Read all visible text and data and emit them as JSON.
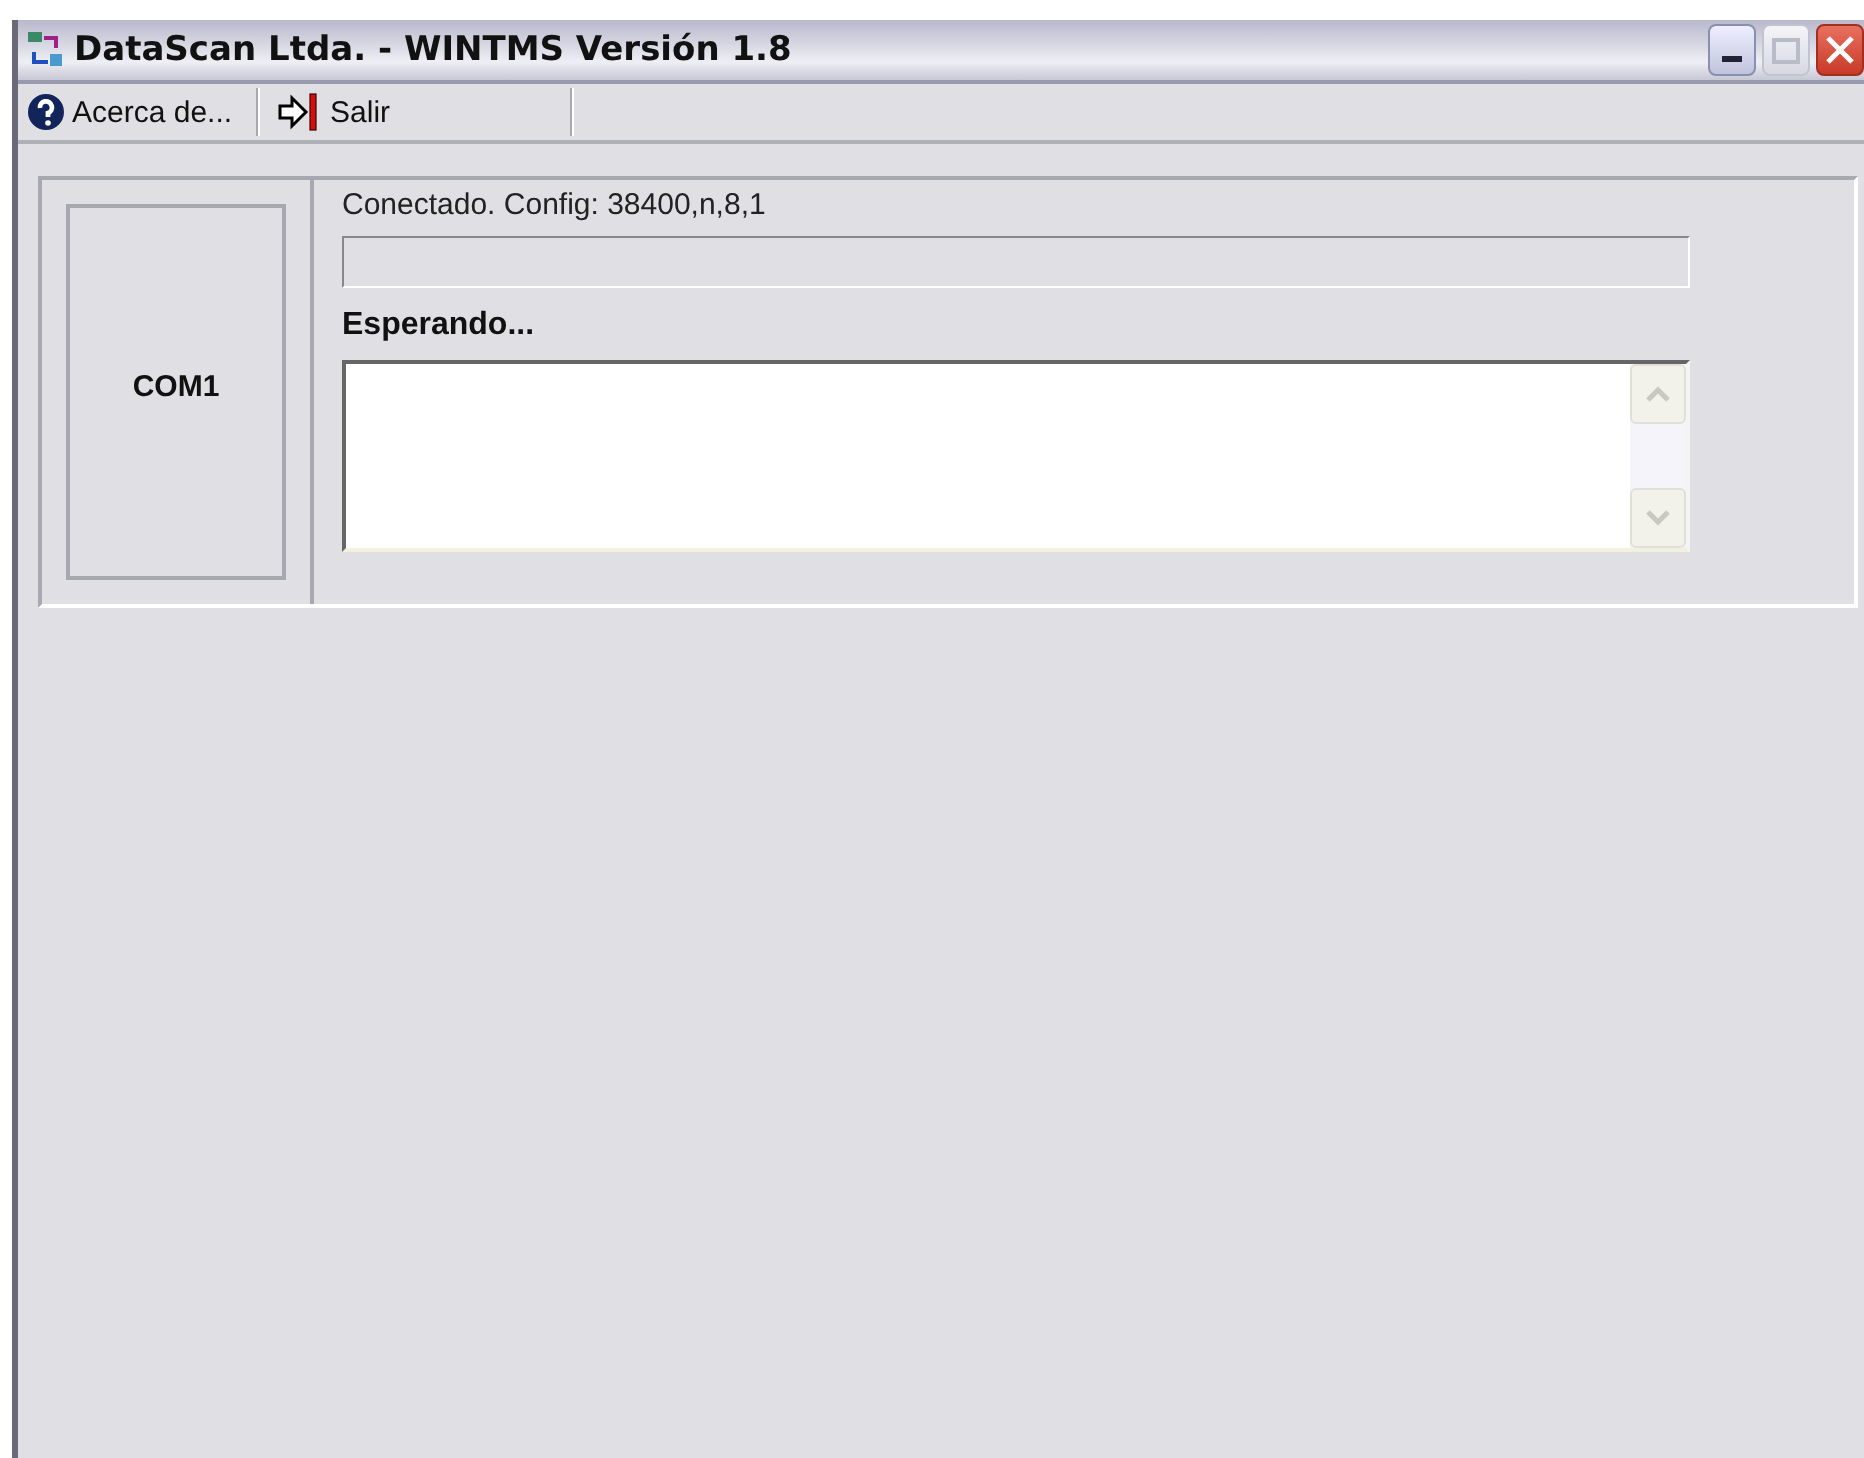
{
  "window": {
    "title": "DataScan Ltda. - WINTMS Versión 1.8"
  },
  "toolbar": [
    {
      "label": "Acerca de...",
      "kind": "help"
    },
    {
      "label": "Salir",
      "kind": "exit"
    }
  ],
  "port": {
    "name": "COM1",
    "status": "Conectado. Config: 38400,n,8,1",
    "progress": {
      "level": 0
    },
    "message": "Esperando..."
  }
}
